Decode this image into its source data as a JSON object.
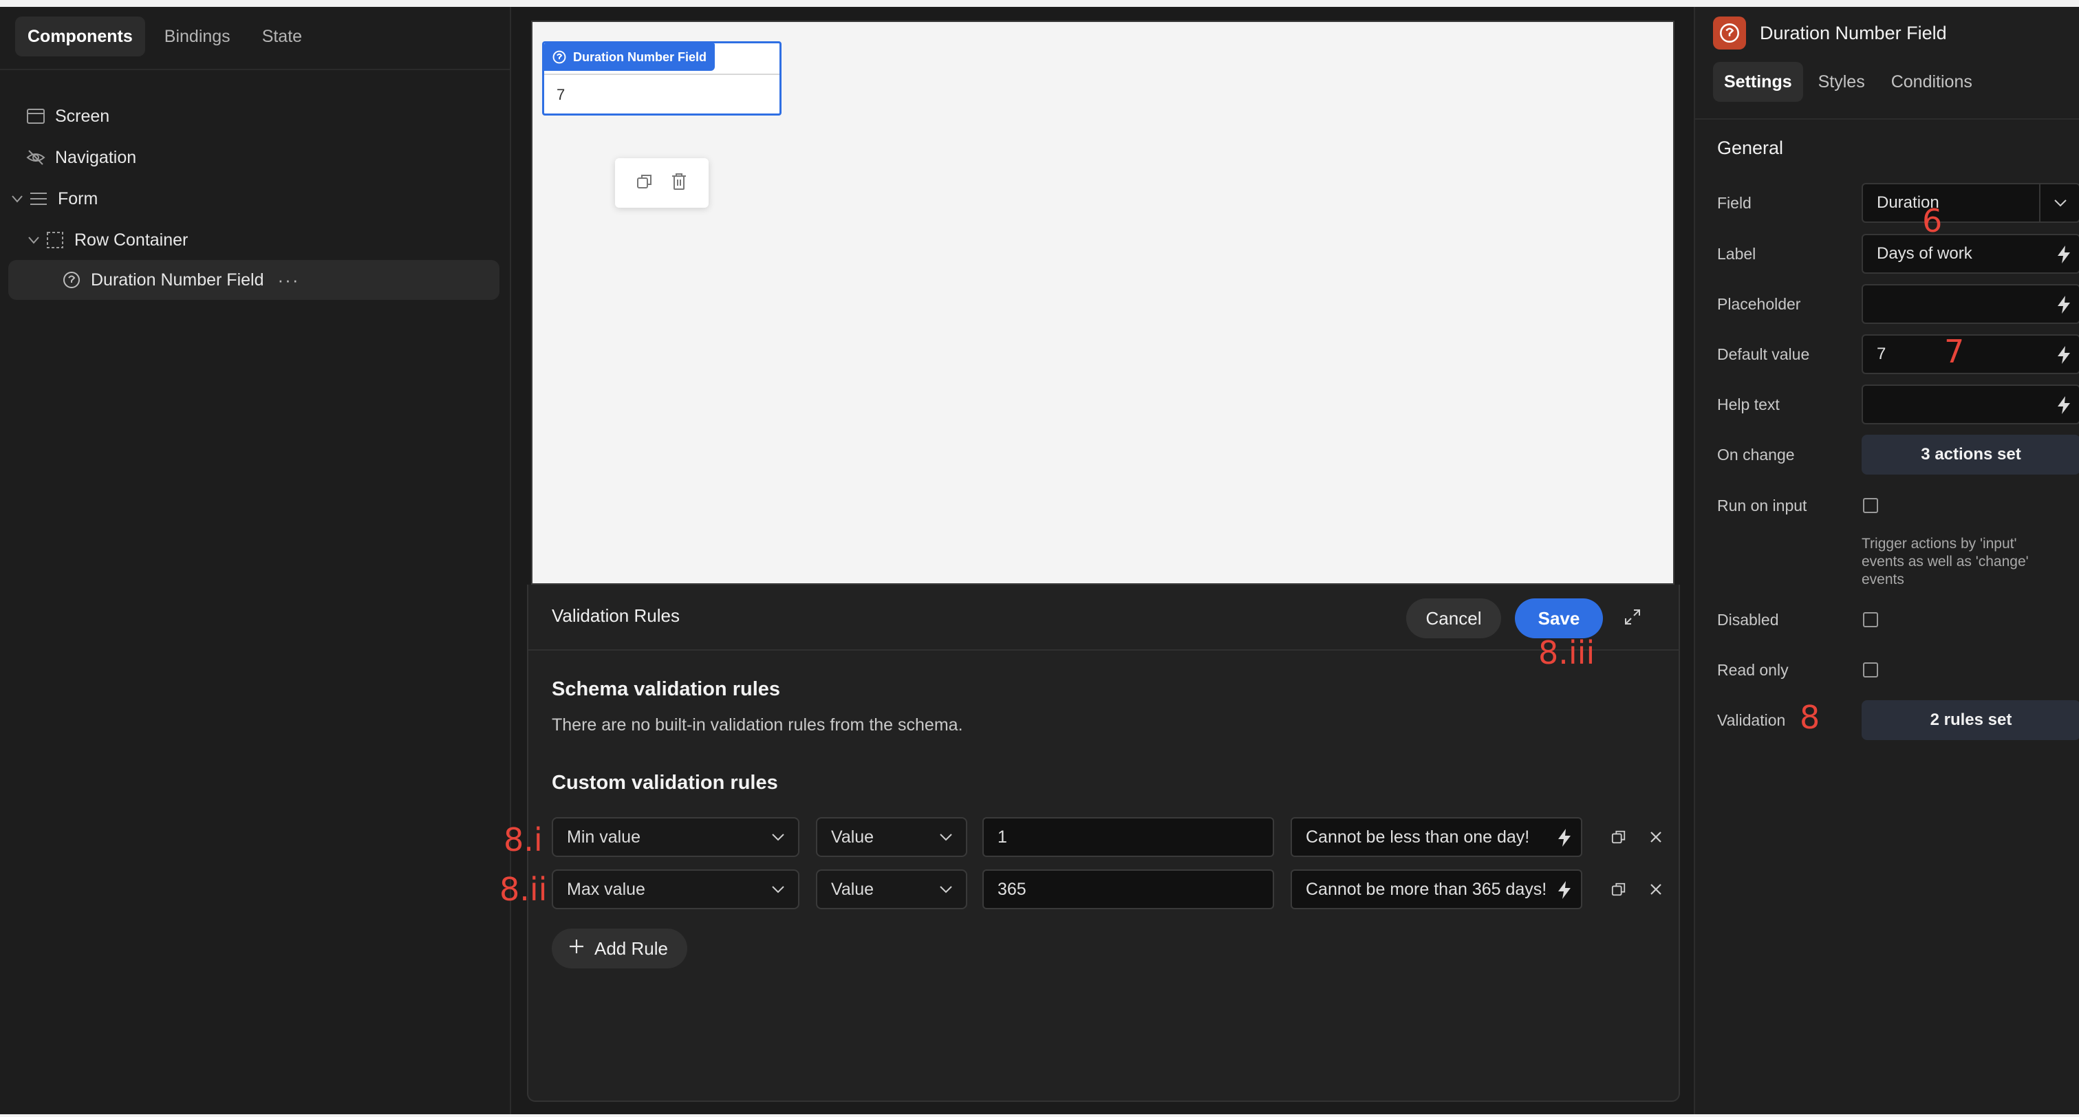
{
  "left_panel": {
    "tabs": [
      "Components",
      "Bindings",
      "State"
    ],
    "tree": {
      "screen": "Screen",
      "navigation": "Navigation",
      "form": "Form",
      "row_container": "Row Container",
      "field": "Duration Number Field",
      "more": "···"
    }
  },
  "canvas": {
    "component_tag": "Duration Number Field",
    "component_value": "7"
  },
  "validation": {
    "title": "Validation Rules",
    "cancel_label": "Cancel",
    "save_label": "Save",
    "schema_heading": "Schema validation rules",
    "schema_text": "There are no built-in validation rules from the schema.",
    "custom_heading": "Custom validation rules",
    "rules": [
      {
        "type": "Min value",
        "source": "Value",
        "value": "1",
        "message": "Cannot be less than one day!"
      },
      {
        "type": "Max value",
        "source": "Value",
        "value": "365",
        "message": "Cannot be more than 365 days!"
      }
    ],
    "add_rule_label": "Add Rule"
  },
  "right_panel": {
    "title": "Duration Number Field",
    "tabs": [
      "Settings",
      "Styles",
      "Conditions"
    ],
    "section": "General",
    "field_label": "Field",
    "field_value": "Duration",
    "label_label": "Label",
    "label_value": "Days of work",
    "placeholder_label": "Placeholder",
    "placeholder_value": "",
    "default_label": "Default value",
    "default_value": "7",
    "help_label": "Help text",
    "help_value": "",
    "onchange_label": "On change",
    "onchange_value": "3 actions set",
    "runoninput_label": "Run on input",
    "runoninput_hint": "Trigger actions by 'input' events as well as 'change' events",
    "disabled_label": "Disabled",
    "readonly_label": "Read only",
    "validation_label": "Validation",
    "validation_value": "2 rules set"
  },
  "annotations": {
    "a6": "6",
    "a7": "7",
    "a8": "8",
    "a8i": "8.i",
    "a8ii": "8.ii",
    "a8iii": "8.iii"
  },
  "colors": {
    "accent": "#2f6fe3",
    "badge": "#c2452a",
    "annotation": "#e8453a"
  }
}
